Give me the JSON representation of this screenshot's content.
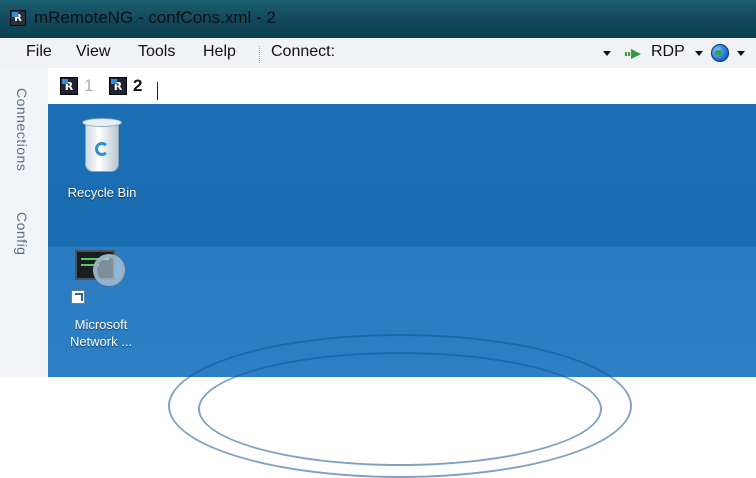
{
  "window": {
    "title": "mRemoteNG - confCons.xml - 2",
    "icon": "mremoteng-app-icon"
  },
  "menu": {
    "items": [
      "File",
      "View",
      "Tools",
      "Help"
    ],
    "connect_label": "Connect:",
    "protocol": "RDP",
    "icons": [
      "dropdown-arrow-icon",
      "rdp-arrow-icon",
      "globe-icon"
    ]
  },
  "tabs": [
    {
      "number": "1",
      "active": false
    },
    {
      "number": "2",
      "active": true
    }
  ],
  "side_panel": {
    "tabs": [
      "Connections",
      "Config"
    ]
  },
  "desktop": {
    "icons": [
      {
        "label": "Recycle Bin",
        "icon": "recycle-bin-icon"
      },
      {
        "label": "Microsoft\nNetwork ...",
        "icon": "network-monitor-icon"
      }
    ]
  },
  "colors": {
    "titlebar": "#12485a",
    "desktop": "#1c6fb5",
    "menubar": "#f0f2f5"
  }
}
